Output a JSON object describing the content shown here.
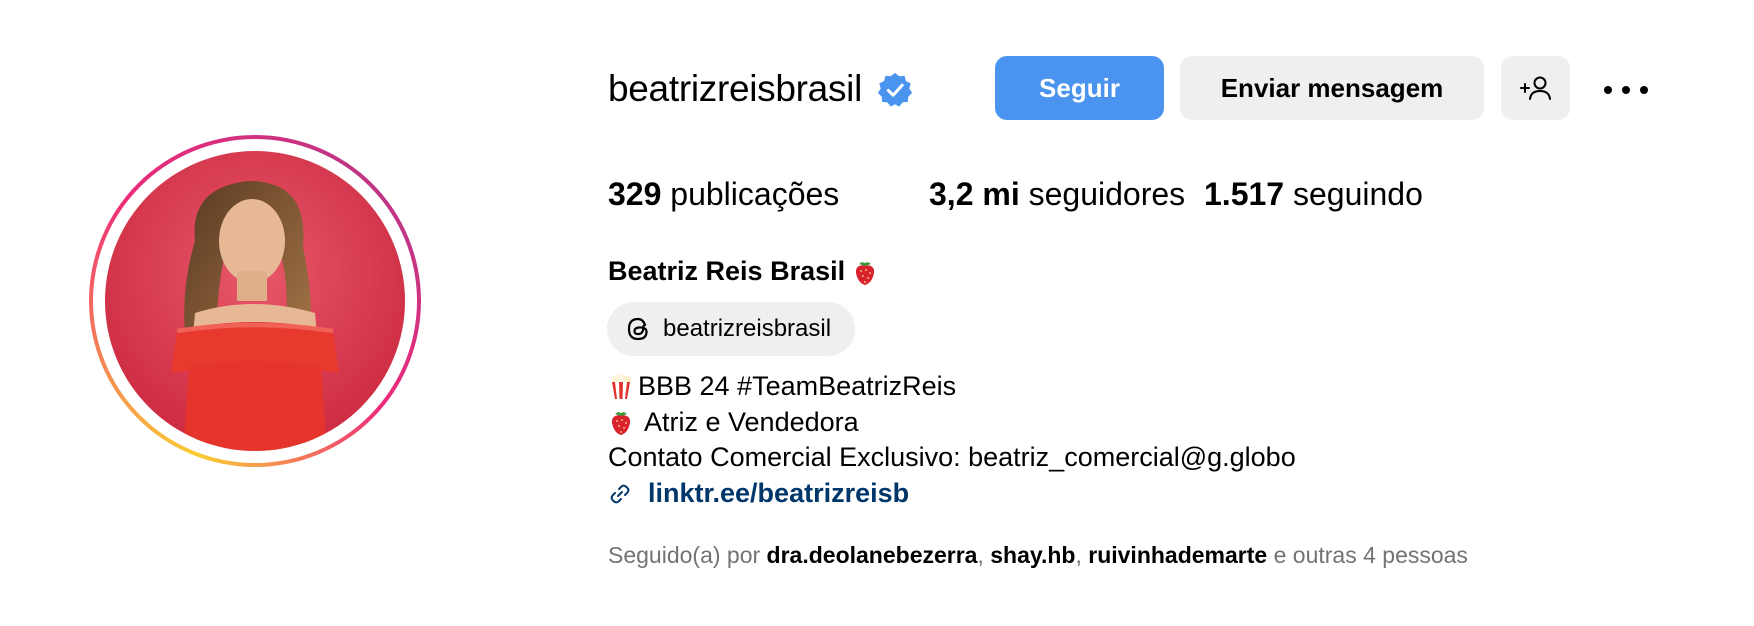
{
  "profile": {
    "username": "beatrizreisbrasil",
    "full_name": "Beatriz Reis Brasil",
    "verified": true,
    "threads_handle": "beatrizreisbrasil"
  },
  "actions": {
    "follow_label": "Seguir",
    "message_label": "Enviar mensagem"
  },
  "stats": {
    "posts_value": "329",
    "posts_label": "publicações",
    "followers_value": "3,2 mi",
    "followers_label": "seguidores",
    "following_value": "1.517",
    "following_label": "seguindo"
  },
  "bio": {
    "line1": "BBB 24 #TeamBeatrizReis",
    "line2": "Atriz e Vendedora",
    "line3": "Contato Comercial Exclusivo: beatriz_comercial@g.globo",
    "link": "linktr.ee/beatrizreisb"
  },
  "followed_by": {
    "prefix": "Seguido(a) por",
    "users": [
      "dra.deolanebezerra",
      "shay.hb",
      "ruivinhademarte"
    ],
    "sep": ",",
    "suffix": "e outras 4 pessoas"
  },
  "colors": {
    "follow_button": "#4a94ef",
    "secondary_button": "#efefef",
    "verified_badge": "#4a94ef",
    "link": "#00376b",
    "muted_text": "#737373"
  },
  "icons": {
    "verified": "verified-badge-icon",
    "add_user": "add-user-icon",
    "more": "more-options-icon",
    "threads": "threads-icon",
    "link": "link-icon",
    "strawberry": "strawberry-emoji",
    "popcorn": "popcorn-emoji"
  }
}
